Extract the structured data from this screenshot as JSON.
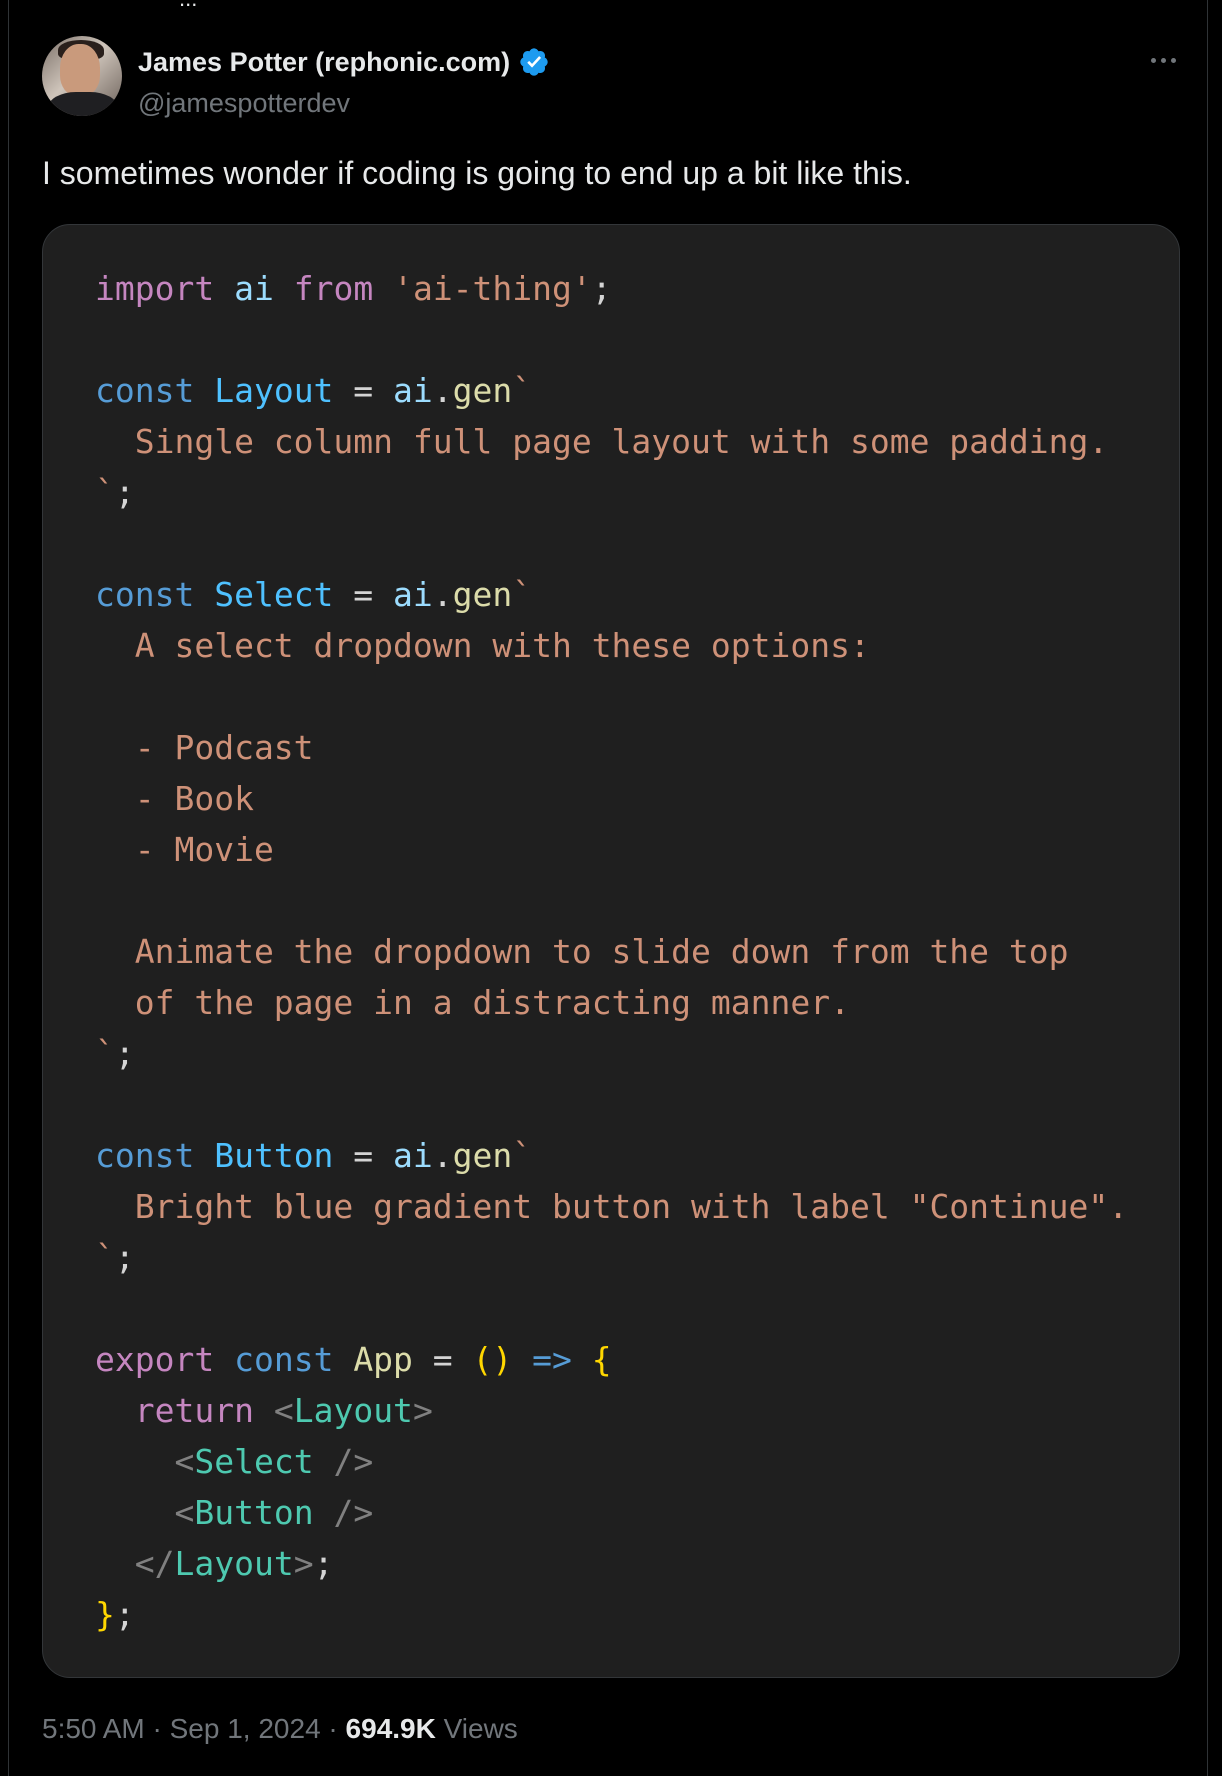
{
  "tweet": {
    "top_fragment": "...",
    "author": {
      "display_name": "James Potter (rephonic.com)",
      "handle": "@jamespotterdev",
      "verified_color": "#1d9bf0"
    },
    "text": "I sometimes wonder if coding is going to end up a bit like this.",
    "footer": {
      "time": "5:50 AM",
      "separator": " · ",
      "date": "Sep 1, 2024",
      "views_count": "694.9K",
      "views_label": " Views"
    }
  },
  "code_colors": {
    "kw_purple": "#c586c0",
    "kw_blue": "#569cd6",
    "ident": "#9cdcfe",
    "type": "#4fc1ff",
    "func": "#dcdcaa",
    "string": "#ce9178",
    "tag": "#4ec9b0",
    "bracket": "#ffd700",
    "punct": "#808080",
    "plain": "#d4d4d4"
  },
  "code_lines": [
    [
      {
        "t": "import",
        "c": "kw_purple"
      },
      {
        "t": " ",
        "c": "plain"
      },
      {
        "t": "ai",
        "c": "ident"
      },
      {
        "t": " ",
        "c": "plain"
      },
      {
        "t": "from",
        "c": "kw_purple"
      },
      {
        "t": " ",
        "c": "plain"
      },
      {
        "t": "'ai-thing'",
        "c": "string"
      },
      {
        "t": ";",
        "c": "plain"
      }
    ],
    [],
    [
      {
        "t": "const",
        "c": "kw_blue"
      },
      {
        "t": " ",
        "c": "plain"
      },
      {
        "t": "Layout",
        "c": "type"
      },
      {
        "t": " = ",
        "c": "plain"
      },
      {
        "t": "ai",
        "c": "ident"
      },
      {
        "t": ".",
        "c": "plain"
      },
      {
        "t": "gen",
        "c": "func"
      },
      {
        "t": "`",
        "c": "string"
      }
    ],
    [
      {
        "t": "  Single column full page layout with some padding.",
        "c": "string"
      }
    ],
    [
      {
        "t": "`",
        "c": "string"
      },
      {
        "t": ";",
        "c": "plain"
      }
    ],
    [],
    [
      {
        "t": "const",
        "c": "kw_blue"
      },
      {
        "t": " ",
        "c": "plain"
      },
      {
        "t": "Select",
        "c": "type"
      },
      {
        "t": " = ",
        "c": "plain"
      },
      {
        "t": "ai",
        "c": "ident"
      },
      {
        "t": ".",
        "c": "plain"
      },
      {
        "t": "gen",
        "c": "func"
      },
      {
        "t": "`",
        "c": "string"
      }
    ],
    [
      {
        "t": "  A select dropdown with these options:",
        "c": "string"
      }
    ],
    [],
    [
      {
        "t": "  - Podcast",
        "c": "string"
      }
    ],
    [
      {
        "t": "  - Book",
        "c": "string"
      }
    ],
    [
      {
        "t": "  - Movie",
        "c": "string"
      }
    ],
    [],
    [
      {
        "t": "  Animate the dropdown to slide down from the top",
        "c": "string"
      }
    ],
    [
      {
        "t": "  of the page in a distracting manner.",
        "c": "string"
      }
    ],
    [
      {
        "t": "`",
        "c": "string"
      },
      {
        "t": ";",
        "c": "plain"
      }
    ],
    [],
    [
      {
        "t": "const",
        "c": "kw_blue"
      },
      {
        "t": " ",
        "c": "plain"
      },
      {
        "t": "Button",
        "c": "type"
      },
      {
        "t": " = ",
        "c": "plain"
      },
      {
        "t": "ai",
        "c": "ident"
      },
      {
        "t": ".",
        "c": "plain"
      },
      {
        "t": "gen",
        "c": "func"
      },
      {
        "t": "`",
        "c": "string"
      }
    ],
    [
      {
        "t": "  Bright blue gradient button with label \"Continue\".",
        "c": "string"
      }
    ],
    [
      {
        "t": "`",
        "c": "string"
      },
      {
        "t": ";",
        "c": "plain"
      }
    ],
    [],
    [
      {
        "t": "export",
        "c": "kw_purple"
      },
      {
        "t": " ",
        "c": "plain"
      },
      {
        "t": "const",
        "c": "kw_blue"
      },
      {
        "t": " ",
        "c": "plain"
      },
      {
        "t": "App",
        "c": "func"
      },
      {
        "t": " = ",
        "c": "plain"
      },
      {
        "t": "()",
        "c": "bracket"
      },
      {
        "t": " ",
        "c": "plain"
      },
      {
        "t": "=>",
        "c": "kw_blue"
      },
      {
        "t": " ",
        "c": "plain"
      },
      {
        "t": "{",
        "c": "bracket"
      }
    ],
    [
      {
        "t": "  ",
        "c": "plain"
      },
      {
        "t": "return",
        "c": "kw_purple"
      },
      {
        "t": " ",
        "c": "plain"
      },
      {
        "t": "<",
        "c": "punct"
      },
      {
        "t": "Layout",
        "c": "tag"
      },
      {
        "t": ">",
        "c": "punct"
      }
    ],
    [
      {
        "t": "    ",
        "c": "plain"
      },
      {
        "t": "<",
        "c": "punct"
      },
      {
        "t": "Select",
        "c": "tag"
      },
      {
        "t": " />",
        "c": "punct"
      }
    ],
    [
      {
        "t": "    ",
        "c": "plain"
      },
      {
        "t": "<",
        "c": "punct"
      },
      {
        "t": "Button",
        "c": "tag"
      },
      {
        "t": " />",
        "c": "punct"
      }
    ],
    [
      {
        "t": "  ",
        "c": "plain"
      },
      {
        "t": "</",
        "c": "punct"
      },
      {
        "t": "Layout",
        "c": "tag"
      },
      {
        "t": ">",
        "c": "punct"
      },
      {
        "t": ";",
        "c": "plain"
      }
    ],
    [
      {
        "t": "}",
        "c": "bracket"
      },
      {
        "t": ";",
        "c": "plain"
      }
    ]
  ]
}
